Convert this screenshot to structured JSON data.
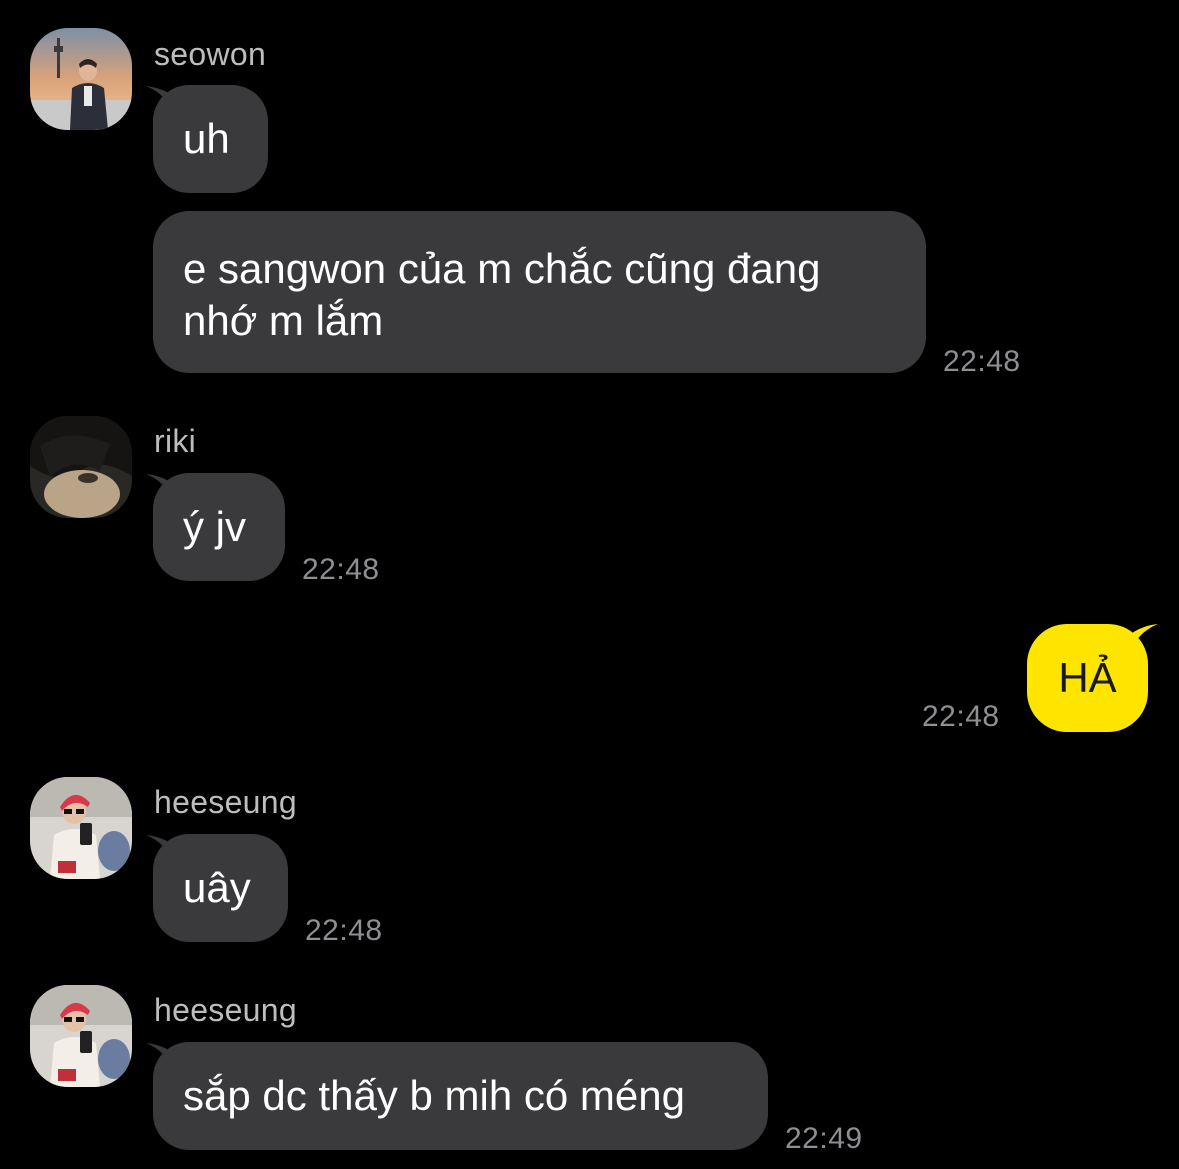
{
  "colors": {
    "background": "#000000",
    "incoming_bubble": "#3a3a3c",
    "outgoing_bubble": "#fee500",
    "timestamp": "#8e8e93",
    "sender_name": "#bdbdbd"
  },
  "messages": [
    {
      "sender": "seowon",
      "avatar": "seowon-avatar",
      "text": "uh"
    },
    {
      "text": "e sangwon của m chắc cũng đang nhớ m lắm",
      "time": "22:48"
    },
    {
      "sender": "riki",
      "avatar": "riki-avatar",
      "text": "ý jv",
      "time": "22:48"
    },
    {
      "outgoing": true,
      "text": "HẢ",
      "time": "22:48"
    },
    {
      "sender": "heeseung",
      "avatar": "heeseung-avatar",
      "text": "uây",
      "time": "22:48"
    },
    {
      "sender": "heeseung",
      "avatar": "heeseung-avatar",
      "text": "sắp dc thấy b mih có méng",
      "time": "22:49"
    }
  ]
}
